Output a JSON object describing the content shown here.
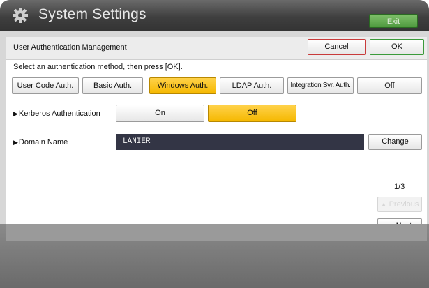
{
  "header": {
    "title": "System Settings",
    "exit_label": "Exit"
  },
  "screen": {
    "title": "User Authentication Management",
    "cancel_label": "Cancel",
    "ok_label": "OK",
    "instruction": "Select an authentication method, then press [OK]."
  },
  "methods": [
    {
      "label": "User Code Auth.",
      "selected": false
    },
    {
      "label": "Basic Auth.",
      "selected": false
    },
    {
      "label": "Windows Auth.",
      "selected": true
    },
    {
      "label": "LDAP Auth.",
      "selected": false
    },
    {
      "label": "Integration Svr. Auth.",
      "selected": false
    },
    {
      "label": "Off",
      "selected": false
    }
  ],
  "kerberos": {
    "label": "Kerberos Authentication",
    "on_label": "On",
    "off_label": "Off",
    "selected": "Off"
  },
  "domain": {
    "label": "Domain Name",
    "value": "LANIER",
    "change_label": "Change"
  },
  "pagination": {
    "indicator": "1/3",
    "previous_label": "Previous",
    "next_label": "Next"
  },
  "colors": {
    "selected": "#f5b800",
    "ok_border": "#3a9a3a",
    "cancel_border": "#c83a3a",
    "field_bg": "#333545"
  }
}
